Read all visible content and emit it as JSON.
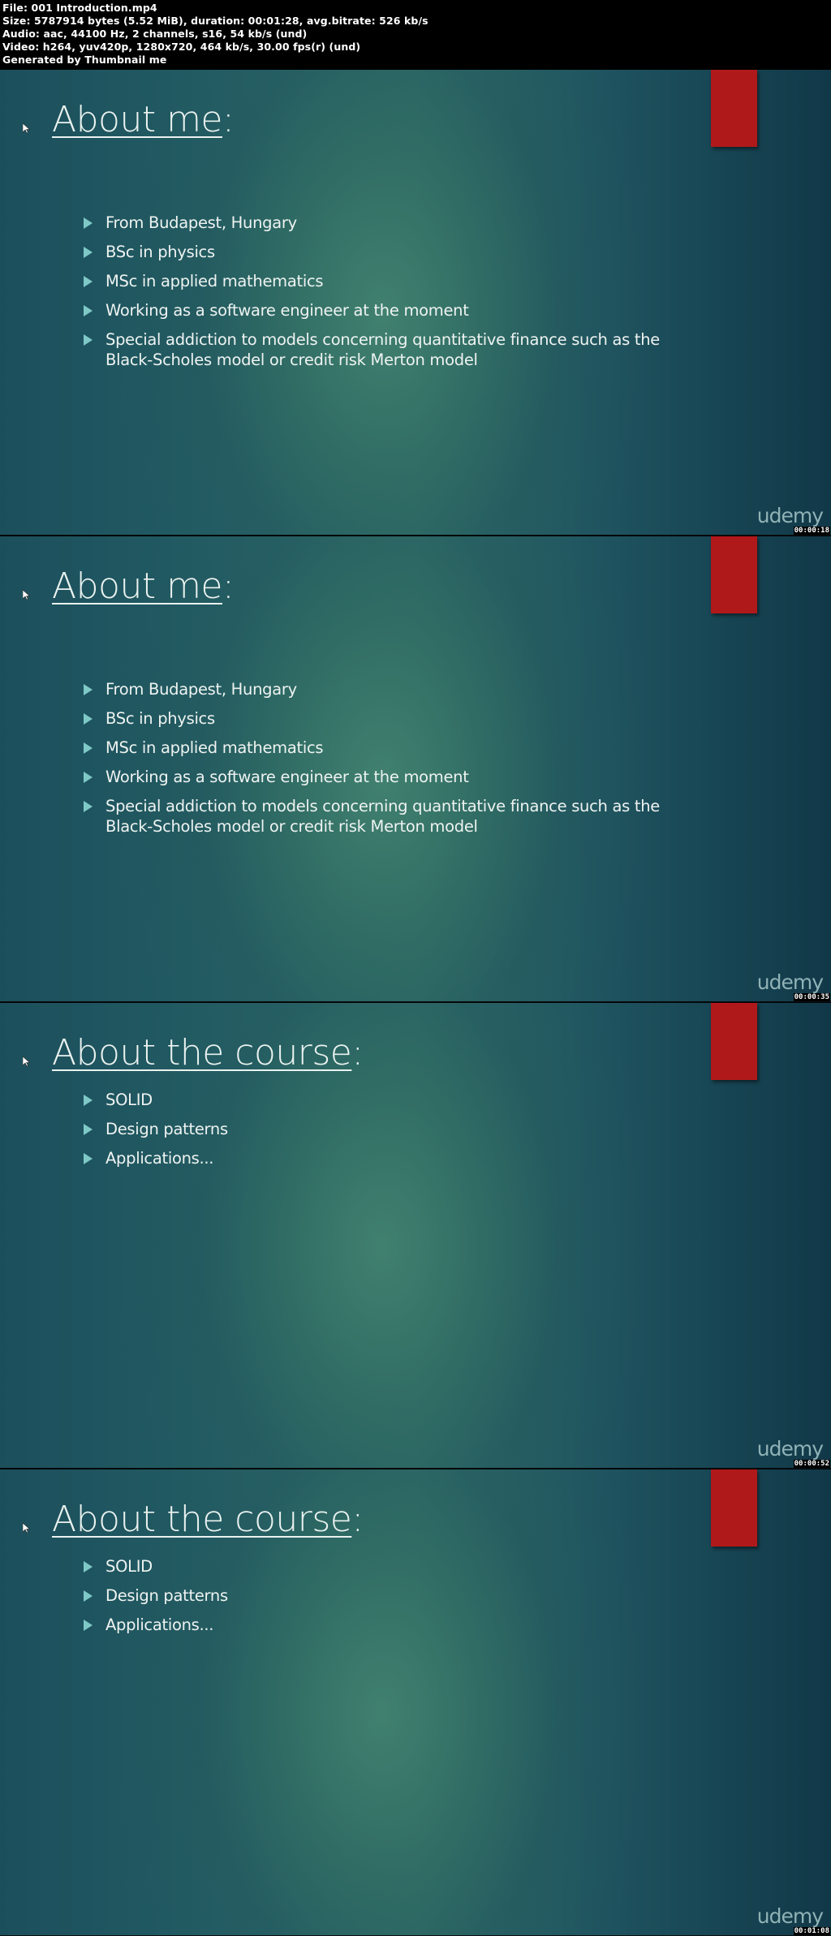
{
  "header": {
    "lines": [
      "File: 001 Introduction.mp4",
      "Size: 5787914 bytes (5.52 MiB), duration: 00:01:28, avg.bitrate: 526 kb/s",
      "Audio: aac, 44100 Hz, 2 channels, s16, 54 kb/s (und)",
      "Video: h264, yuv420p, 1280x720, 464 kb/s, 30.00 fps(r) (und)",
      "Generated by Thumbnail me"
    ]
  },
  "colors": {
    "accent_red": "#b0191a",
    "bullet": "#7fc8c8",
    "background_dark": "#113848",
    "background_light": "#3f7e6f"
  },
  "frames": [
    {
      "title": "About me",
      "title_suffix": ":",
      "bullets": [
        "From Budapest, Hungary",
        "BSc in physics",
        "MSc in applied mathematics",
        "Working as a software engineer at the moment",
        "Special addiction to models concerning quantitative finance such as the Black-Scholes model or credit risk Merton model"
      ],
      "watermark": "udemy",
      "timestamp": "00:00:18"
    },
    {
      "title": "About me",
      "title_suffix": ":",
      "bullets": [
        "From Budapest, Hungary",
        "BSc in physics",
        "MSc in applied mathematics",
        "Working as a software engineer at the moment",
        "Special addiction to models concerning quantitative finance such as the Black-Scholes model or credit risk Merton model"
      ],
      "watermark": "udemy",
      "timestamp": "00:00:35"
    },
    {
      "title": "About the course",
      "title_suffix": ":",
      "bullets": [
        "SOLID",
        "Design patterns",
        "Applications..."
      ],
      "watermark": "udemy",
      "timestamp": "00:00:52"
    },
    {
      "title": "About the course",
      "title_suffix": ":",
      "bullets": [
        "SOLID",
        "Design patterns",
        "Applications..."
      ],
      "watermark": "udemy",
      "timestamp": "00:01:08"
    }
  ]
}
